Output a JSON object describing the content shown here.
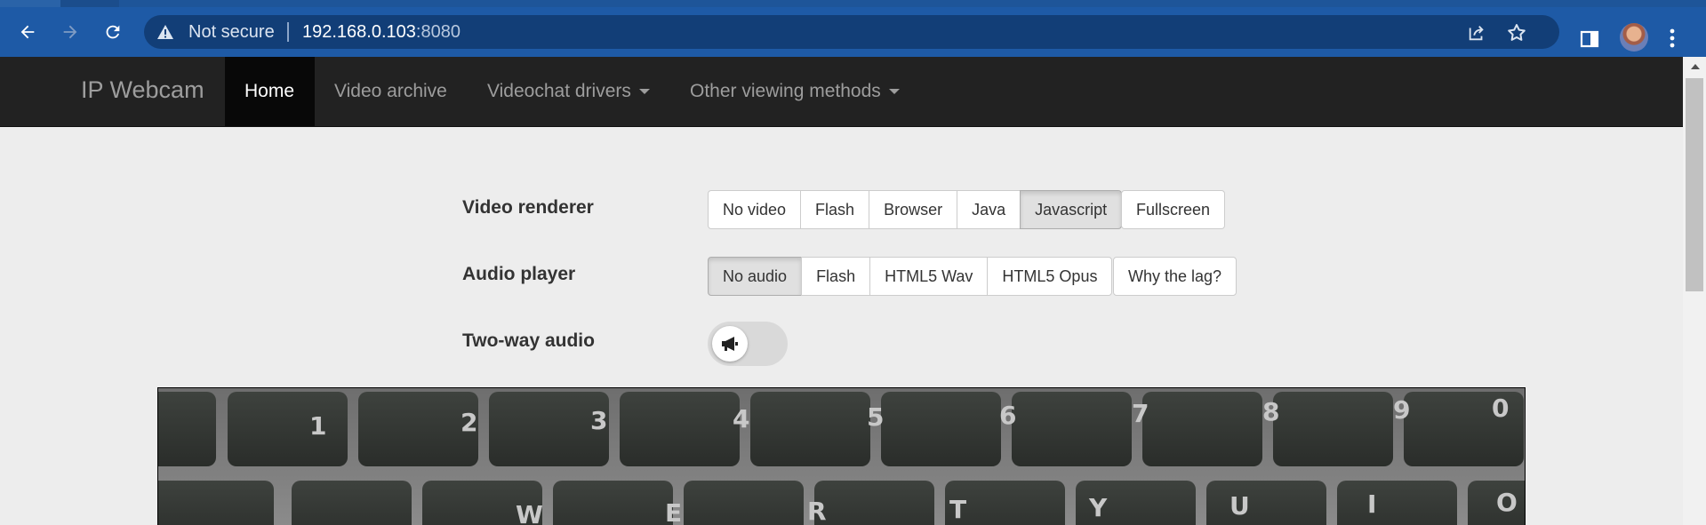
{
  "browser": {
    "security_label": "Not secure",
    "url_host": "192.168.0.103",
    "url_port": ":8080",
    "icons": [
      "back-icon",
      "forward-icon",
      "reload-icon",
      "warning-icon",
      "share-icon",
      "star-icon",
      "side-panel-icon",
      "avatar",
      "kebab-menu-icon"
    ]
  },
  "navbar": {
    "brand": "IP Webcam",
    "items": [
      {
        "label": "Home",
        "active": true,
        "dropdown": false
      },
      {
        "label": "Video archive",
        "active": false,
        "dropdown": false
      },
      {
        "label": "Videochat drivers",
        "active": false,
        "dropdown": true
      },
      {
        "label": "Other viewing methods",
        "active": false,
        "dropdown": true
      }
    ]
  },
  "controls": {
    "video_renderer": {
      "label": "Video renderer",
      "options": [
        "No video",
        "Flash",
        "Browser",
        "Java",
        "Javascript"
      ],
      "selected": "Javascript",
      "extra_button": "Fullscreen"
    },
    "audio_player": {
      "label": "Audio player",
      "options": [
        "No audio",
        "Flash",
        "HTML5 Wav",
        "HTML5 Opus"
      ],
      "selected": "No audio",
      "extra_button": "Why the lag?"
    },
    "two_way_audio": {
      "label": "Two-way audio",
      "enabled": false,
      "icon": "megaphone-icon"
    }
  },
  "video": {
    "keyboard_keys": [
      "1",
      "2",
      "3",
      "4",
      "5",
      "6",
      "7",
      "8",
      "9",
      "0",
      "W",
      "E",
      "R",
      "T",
      "Y",
      "U",
      "I",
      "O"
    ]
  },
  "colors": {
    "browser_toolbar": "#1e5aa6",
    "navbar_bg": "#222222",
    "page_bg": "#ededed"
  }
}
